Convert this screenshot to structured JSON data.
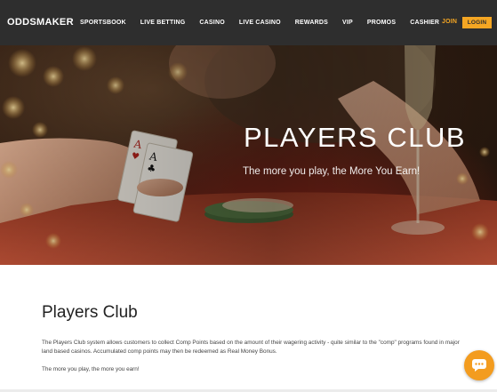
{
  "header": {
    "logo": "ODDSMAKER",
    "nav": [
      "SPORTSBOOK",
      "LIVE BETTING",
      "CASINO",
      "LIVE CASINO",
      "REWARDS",
      "VIP",
      "PROMOS",
      "CASHIER"
    ],
    "join": "JOIN",
    "login": "LOGIN"
  },
  "hero": {
    "title": "PLAYERS CLUB",
    "subtitle": "The more you play, the More You Earn!"
  },
  "content": {
    "title": "Players Club",
    "paragraph": "The Players Club system allows customers to collect Comp Points based on the amount of their wagering activity - quite similar to the \"comp\" programs found in major land based casinos. Accumulated comp points may then be redeemed as Real Money Bonus.",
    "paragraph2": "The more you play, the more you earn!"
  },
  "chat": {
    "icon": "chat-bubble-icon"
  },
  "colors": {
    "accent": "#f5a623",
    "header_bg": "#2e2e2e"
  }
}
